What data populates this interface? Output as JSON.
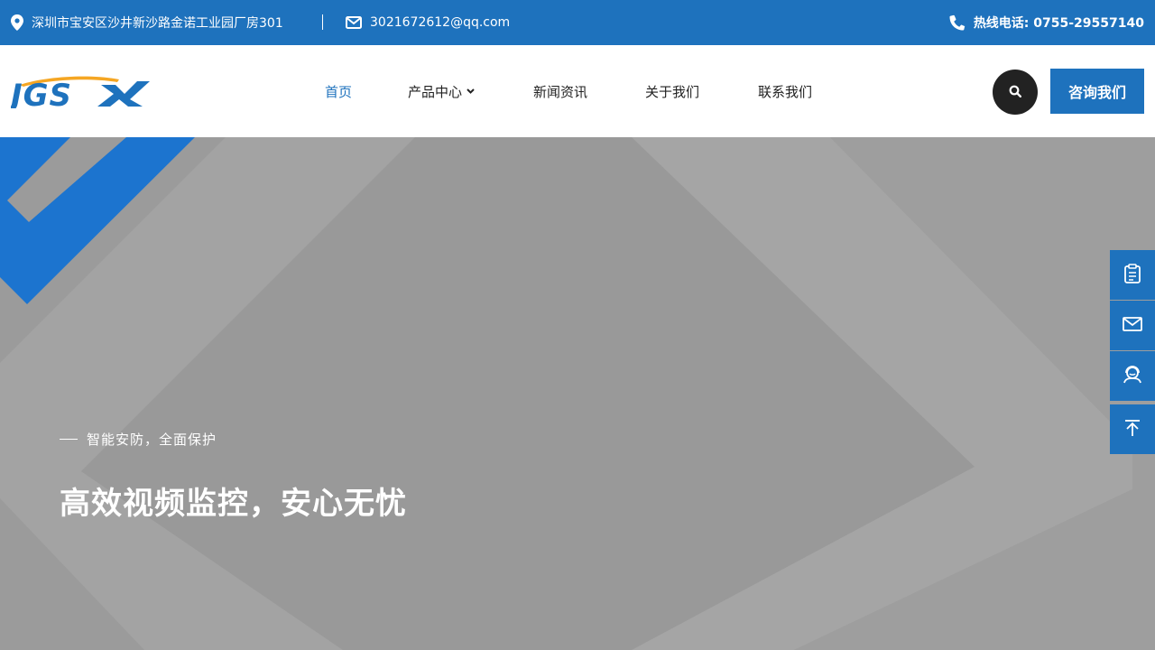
{
  "topbar": {
    "address": "深圳市宝安区沙井新沙路金诺工业园厂房301",
    "email": "3021672612@qq.com",
    "hotline": "热线电话: 0755-29557140"
  },
  "logo": {
    "text": "JGSX"
  },
  "nav": {
    "items": [
      {
        "label": "首页",
        "active": true
      },
      {
        "label": "产品中心",
        "has_dropdown": true
      },
      {
        "label": "新闻资讯"
      },
      {
        "label": "关于我们"
      },
      {
        "label": "联系我们"
      }
    ]
  },
  "header": {
    "consult_label": "咨询我们"
  },
  "hero": {
    "subtitle": "智能安防，全面保护",
    "headline": "高效视频监控，安心无忧"
  },
  "colors": {
    "brand": "#1e72bd",
    "logo_orange": "#f5a623",
    "dark_button": "#222222"
  }
}
